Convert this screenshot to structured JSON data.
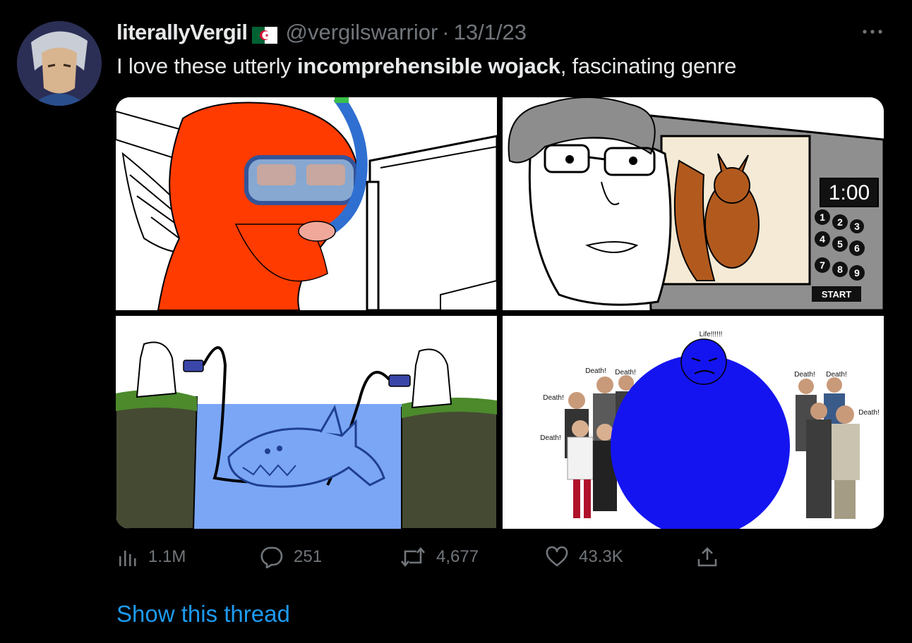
{
  "author": {
    "display_name": "literallyVergil",
    "flag_icon": "algeria-flag-icon",
    "handle": "@vergilswarrior",
    "separator": "·",
    "date": "13/1/23"
  },
  "tweet": {
    "text_before": "I love these utterly ",
    "text_bold": "incomprehensible wojack",
    "text_after": ", fascinating genre"
  },
  "media": {
    "panel2_clock": "1:00",
    "panel2_keys": [
      "1",
      "2",
      "3",
      "4",
      "5",
      "6",
      "7",
      "8",
      "9"
    ],
    "panel2_start": "START",
    "panel4_top_label": "Life!!!!!!",
    "panel4_labels": [
      "Death!",
      "Death!",
      "Death!",
      "Death!",
      "Death!",
      "Death!",
      "Death!"
    ]
  },
  "actions": {
    "views": "1.1M",
    "replies": "251",
    "retweets": "4,677",
    "likes": "43.3K"
  },
  "show_thread": "Show this thread",
  "colors": {
    "background": "#000000",
    "text": "#e7e9ea",
    "muted": "#71767b",
    "link": "#1d9bf0"
  }
}
